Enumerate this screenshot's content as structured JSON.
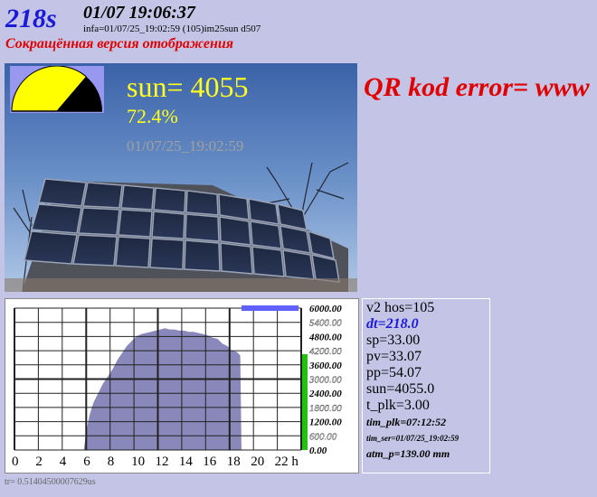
{
  "header": {
    "elapsed": "218s",
    "datetime": "01/07 19:06:37",
    "info": "infa=01/07/25_19:02:59  (105)im25sun  d507",
    "mode": "Сокращённая версия отображения"
  },
  "photo": {
    "sun_value": "sun= 4055",
    "sun_percent": "72.4%",
    "timestamp": "01/07/25_19:02:59",
    "gauge_fraction": 0.724
  },
  "qr_error": "QR kod error=  www",
  "chart_data": {
    "type": "area",
    "x_ticks": [
      "0",
      "2",
      "4",
      "6",
      "8",
      "10",
      "12",
      "14",
      "16",
      "18",
      "20",
      "22 h"
    ],
    "y_ticks": [
      "6000.00",
      "5400.00",
      "4800.00",
      "4200.00",
      "3600.00",
      "3000.00",
      "2400.00",
      "1800.00",
      "1200.00",
      "600.00",
      "0.00"
    ],
    "xlim": [
      0,
      24
    ],
    "ylim": [
      0,
      6000
    ],
    "series": [
      {
        "x": [
          5.8,
          6.0,
          6.3,
          6.6,
          7.0,
          7.4,
          7.8,
          8.2,
          8.6,
          9.0,
          9.4,
          9.8,
          10.2,
          10.6,
          11.0,
          11.4,
          11.8,
          12.2,
          12.6,
          13.0,
          13.4,
          13.8,
          14.2,
          14.6,
          15.0,
          15.4,
          15.8,
          16.2,
          16.6,
          17.0,
          17.4,
          17.8,
          18.2,
          18.6,
          18.9,
          19.0
        ],
        "y": [
          0,
          800,
          1500,
          2000,
          2400,
          2800,
          3100,
          3400,
          3800,
          4100,
          4400,
          4600,
          4800,
          4900,
          4950,
          5000,
          5050,
          5100,
          5150,
          5100,
          5100,
          5050,
          5050,
          5000,
          5000,
          4950,
          4900,
          4850,
          4750,
          4700,
          4500,
          4400,
          4200,
          4150,
          4000,
          0
        ]
      }
    ],
    "current_bar": {
      "value": 4055,
      "color": "#22c010"
    },
    "top_marker": {
      "from": 19.0,
      "to": 24.0,
      "value": 6000,
      "color": "#6060ff"
    }
  },
  "stats": {
    "hos": "v2 hos=105",
    "dt": "dt=218.0",
    "sp": "sp=33.00",
    "pv": "pv=33.07",
    "pp": "pp=54.07",
    "sun": "sun=4055.0",
    "t_plk": "t_plk=3.00",
    "tim_plk": "tim_plk=07:12:52",
    "tim_ser": "tim_ser=01/07/25_19:02:59",
    "atm_p": "atm_p=139.00 mm"
  },
  "footer": "tr= 0.51404500007629us",
  "colors": {
    "background": "#c4c4e6",
    "elapsed": "#1a1ad8",
    "error_red": "#e00000",
    "sun_yellow": "#ffff20",
    "area_fill": "#8888bb",
    "dt_blue": "#1a1ad8"
  }
}
